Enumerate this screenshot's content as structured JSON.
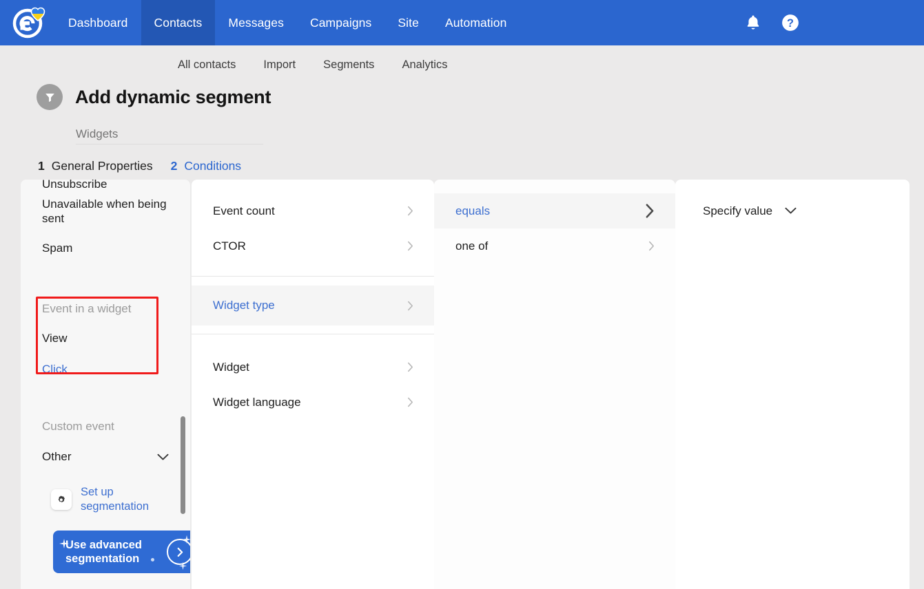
{
  "topnav": {
    "logo_name": "esputnik-logo",
    "items": [
      {
        "label": "Dashboard",
        "active": false
      },
      {
        "label": "Contacts",
        "active": true
      },
      {
        "label": "Messages",
        "active": false
      },
      {
        "label": "Campaigns",
        "active": false
      },
      {
        "label": "Site",
        "active": false
      },
      {
        "label": "Automation",
        "active": false
      }
    ],
    "bell_icon": "bell-icon",
    "help_icon": "help-icon",
    "background": "#2b66cf",
    "active_background": "#2357b4"
  },
  "subnav": {
    "items": [
      "All contacts",
      "Import",
      "Segments",
      "Analytics"
    ]
  },
  "header": {
    "title": "Add dynamic segment",
    "icon": "filter-funnel-icon",
    "segment_name_value": "Widgets",
    "segment_name_placeholder": "Widgets"
  },
  "steps": [
    {
      "number": "1",
      "label": "General Properties",
      "active": false
    },
    {
      "number": "2",
      "label": "Conditions",
      "active": true
    }
  ],
  "columns": {
    "col1": {
      "clipped_top_item": "Unsubscribe",
      "items_top": [
        "Unavailable when being sent",
        "Spam"
      ],
      "group_widget_header": "Event in a widget",
      "group_widget_items": [
        {
          "label": "View",
          "selected": false
        },
        {
          "label": "Click",
          "selected": true
        }
      ],
      "group_custom_header": "Custom event",
      "dropdown_value": "Other",
      "dropdown_caret": "chevron-down-icon",
      "setup_link": "Set up segmentation",
      "setup_icon": "gear-icon",
      "advanced_button": "Use advanced segmentation",
      "advanced_arrow_icon": "circle-arrow-right-icon",
      "highlight_color": "#f01b1b"
    },
    "col2": {
      "group_a": [
        {
          "label": "Event count",
          "selected": false
        },
        {
          "label": "CTOR",
          "selected": false
        }
      ],
      "group_b": [
        {
          "label": "Widget type",
          "selected": true
        }
      ],
      "group_c": [
        {
          "label": "Widget",
          "selected": false
        },
        {
          "label": "Widget language",
          "selected": false
        }
      ]
    },
    "col3": {
      "items": [
        {
          "label": "equals",
          "selected": true
        },
        {
          "label": "one of",
          "selected": false
        }
      ]
    },
    "col4": {
      "value_label": "Specify value",
      "caret_icon": "chevron-down-icon"
    }
  },
  "colors": {
    "brand_blue": "#2b66cf",
    "link_blue": "#3d6fd0",
    "page_bg": "#ebeaea",
    "panel_bg": "#ffffff",
    "panel_alt_bg": "#f7f7f7",
    "selected_row_bg": "#f5f5f5",
    "highlight_red": "#f01b1b"
  }
}
